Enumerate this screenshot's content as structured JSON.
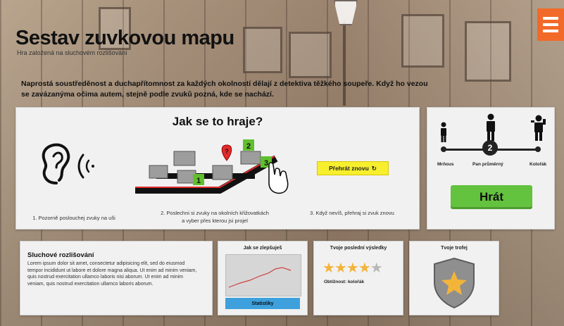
{
  "header": {
    "title": "Sestav zuvkovou mapu",
    "subtitle": "Hra založená na sluchovém rozlišování",
    "intro": "Naprostá soustředěnost a duchapřítomnost za každých okolností dělají z detektiva těžkého soupeře. Když ho vezou se zavázanýma očima autem, stejně podle zvuků pozná, kde se nachází."
  },
  "menu": {
    "icon": "hamburger-icon"
  },
  "howto": {
    "heading": "Jak se to hraje?",
    "step1": "1. Pozorně poslouchej zvuky na uši",
    "step2_line1": "2. Poslechni si zvuky na okolních křižovatkách",
    "step2_line2": "a vyber přes kterou jsi projel",
    "step3": "3. Když nevíš, přehraj si zvuk znovu",
    "replay_label": "Přehrát znovu",
    "map_labels": [
      "1",
      "2",
      "3",
      "?"
    ]
  },
  "difficulty": {
    "level": "2",
    "labels": [
      "Mrňous",
      "Pan průměrný",
      "Kolořák"
    ]
  },
  "play_button": "Hrát",
  "hearing": {
    "title": "Sluchové rozlišování",
    "text": "Lorem ipsum dolor sit amet, consectetur adipisicing elit, sed do eiusmod tempor incididunt ut labore et dolore magna aliqua. Ut enim ad minim veniam, quis nostrud exercitation ullamco laboris nisi aborum. Ut enim ad minim veniam, quis nostrud exercitation ullamco laboris aborum."
  },
  "improve": {
    "title": "Jak se zlepšuješ",
    "stats_button": "Statistiky"
  },
  "results": {
    "title": "Tvoje poslední výsledky",
    "rating": 4,
    "max_rating": 5,
    "difficulty_label": "Obtížnost: kolořák"
  },
  "trophy": {
    "title": "Tvoje trofej"
  },
  "colors": {
    "accent_orange": "#f26a2a",
    "play_green": "#63c23e",
    "replay_yellow": "#f7ef2e",
    "stats_blue": "#3ea1dd",
    "star_gold": "#f3b43a",
    "map_green": "#61bf2f",
    "pin_red": "#e02b2b"
  }
}
